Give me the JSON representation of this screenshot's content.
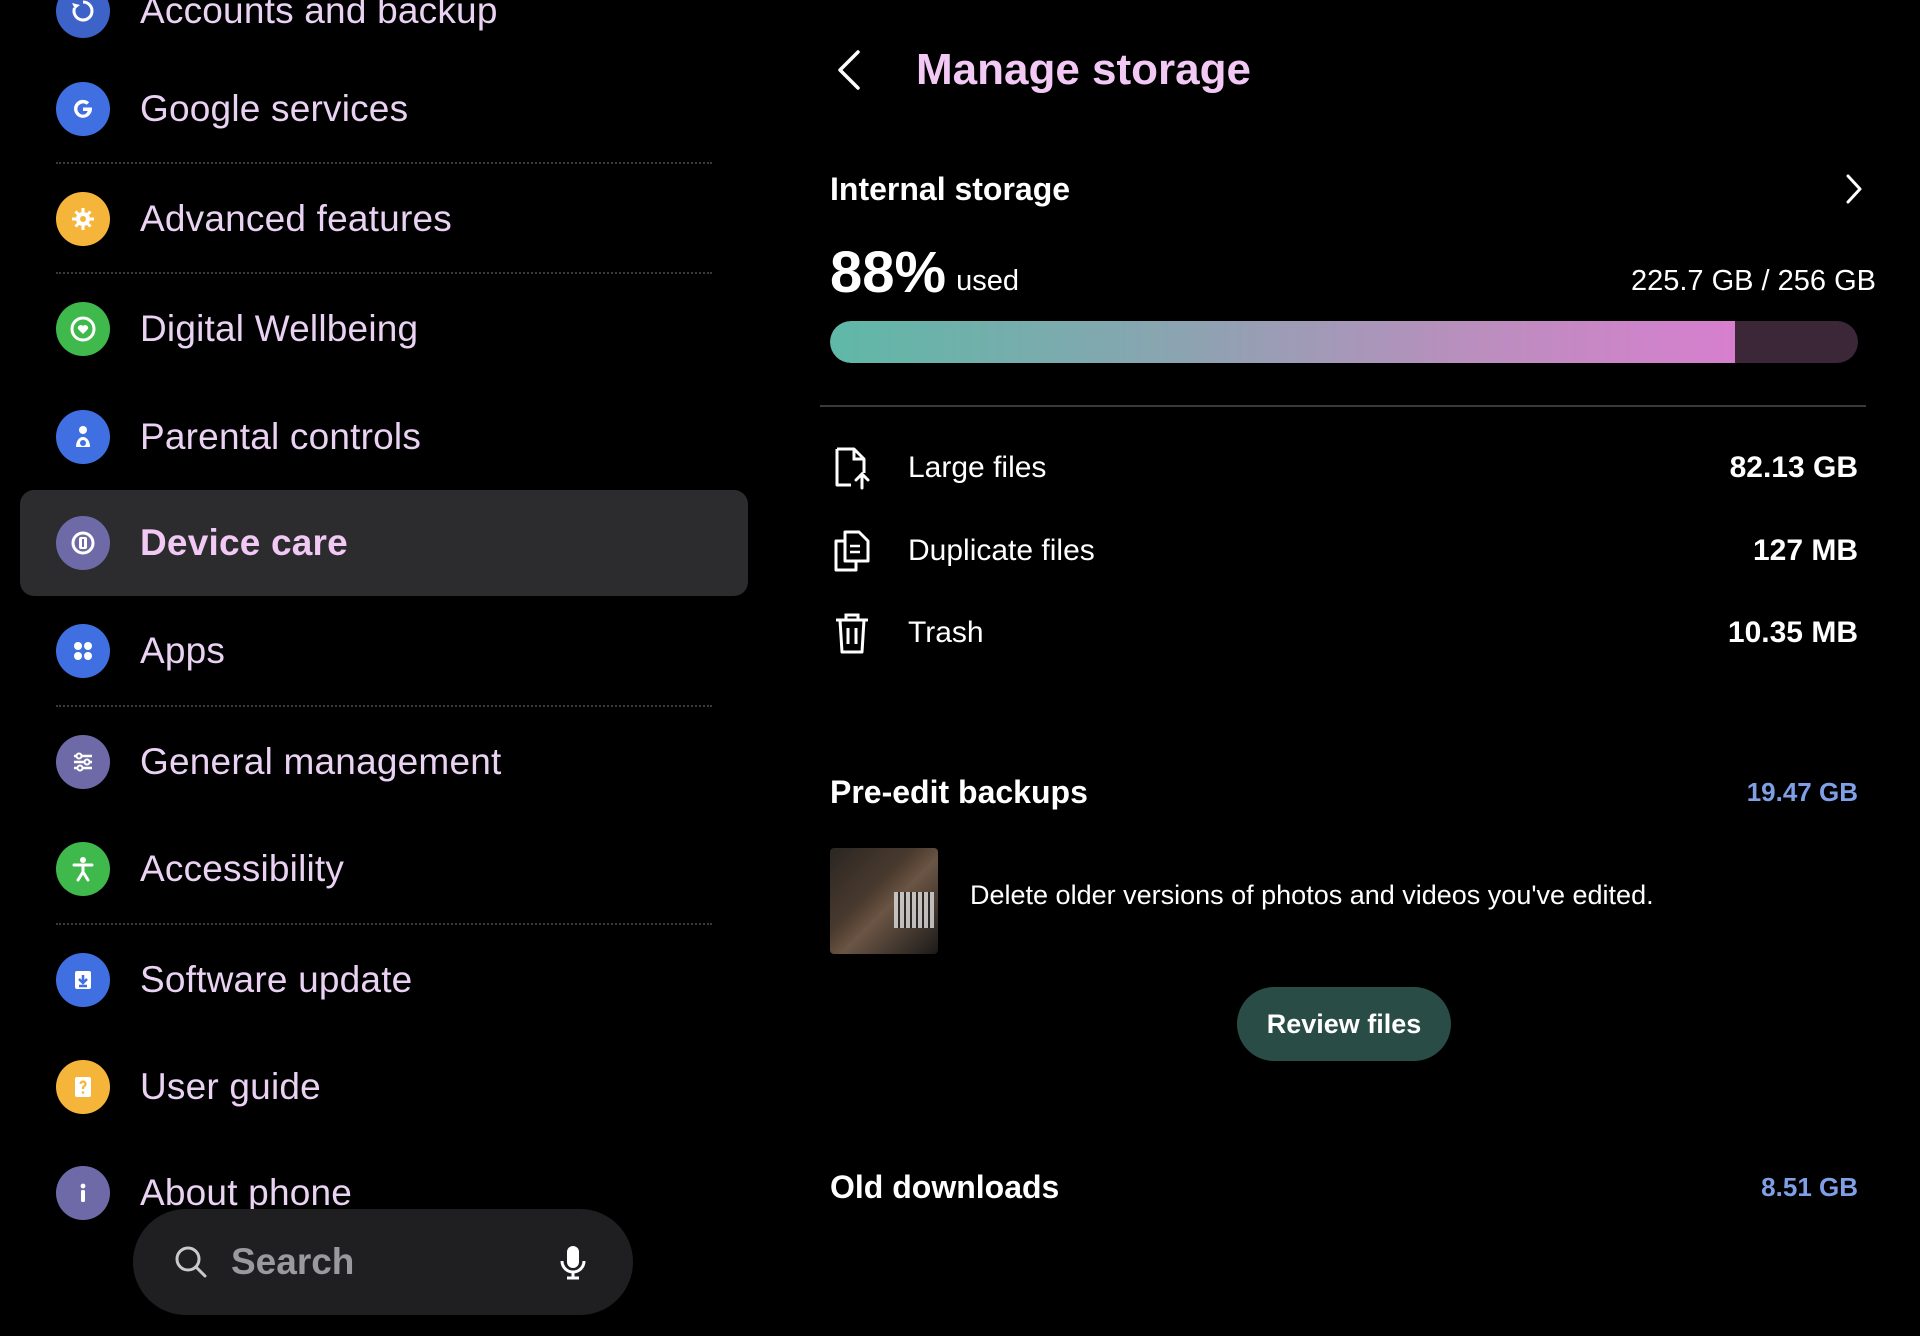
{
  "sidebar": {
    "items": [
      {
        "label": "Accounts and backup",
        "icon": "sync-icon",
        "color": "#3d63c9"
      },
      {
        "label": "Google services",
        "icon": "google-g-icon",
        "color": "#3f6fe0"
      },
      {
        "label": "Advanced features",
        "icon": "puzzle-gear-icon",
        "color": "#f5b53b"
      },
      {
        "label": "Digital Wellbeing",
        "icon": "heart-circle-icon",
        "color": "#3fb84c"
      },
      {
        "label": "Parental controls",
        "icon": "parent-child-icon",
        "color": "#3f6fe0"
      },
      {
        "label": "Device care",
        "icon": "device-care-icon",
        "color": "#6e6aa8"
      },
      {
        "label": "Apps",
        "icon": "apps-grid-icon",
        "color": "#3f6fe0"
      },
      {
        "label": "General management",
        "icon": "sliders-icon",
        "color": "#6e6aa8"
      },
      {
        "label": "Accessibility",
        "icon": "accessibility-person-icon",
        "color": "#3fb84c"
      },
      {
        "label": "Software update",
        "icon": "download-icon",
        "color": "#3f6fe0"
      },
      {
        "label": "User guide",
        "icon": "help-book-icon",
        "color": "#f5b53b"
      },
      {
        "label": "About phone",
        "icon": "info-icon",
        "color": "#6e6aa8"
      }
    ],
    "active": "Device care"
  },
  "search": {
    "placeholder": "Search"
  },
  "header": {
    "title": "Manage storage"
  },
  "storage": {
    "label": "Internal storage",
    "percent": "88%",
    "used_label": "used",
    "total": "225.7 GB / 256 GB",
    "fill_fraction": 0.88
  },
  "files": [
    {
      "name": "Large files",
      "size": "82.13 GB",
      "icon": "large-file-icon"
    },
    {
      "name": "Duplicate files",
      "size": "127 MB",
      "icon": "duplicate-files-icon"
    },
    {
      "name": "Trash",
      "size": "10.35 MB",
      "icon": "trash-icon"
    }
  ],
  "preedit": {
    "title": "Pre-edit backups",
    "size": "19.47 GB",
    "description": "Delete older versions of photos and videos you've edited.",
    "button": "Review files"
  },
  "old_downloads": {
    "title": "Old downloads",
    "size": "8.51 GB"
  },
  "colors": {
    "accent": "#f2c9f5",
    "size_link": "#7f9fe6",
    "active_bg": "#2c2c2e",
    "button_bg": "#2a4c47"
  }
}
